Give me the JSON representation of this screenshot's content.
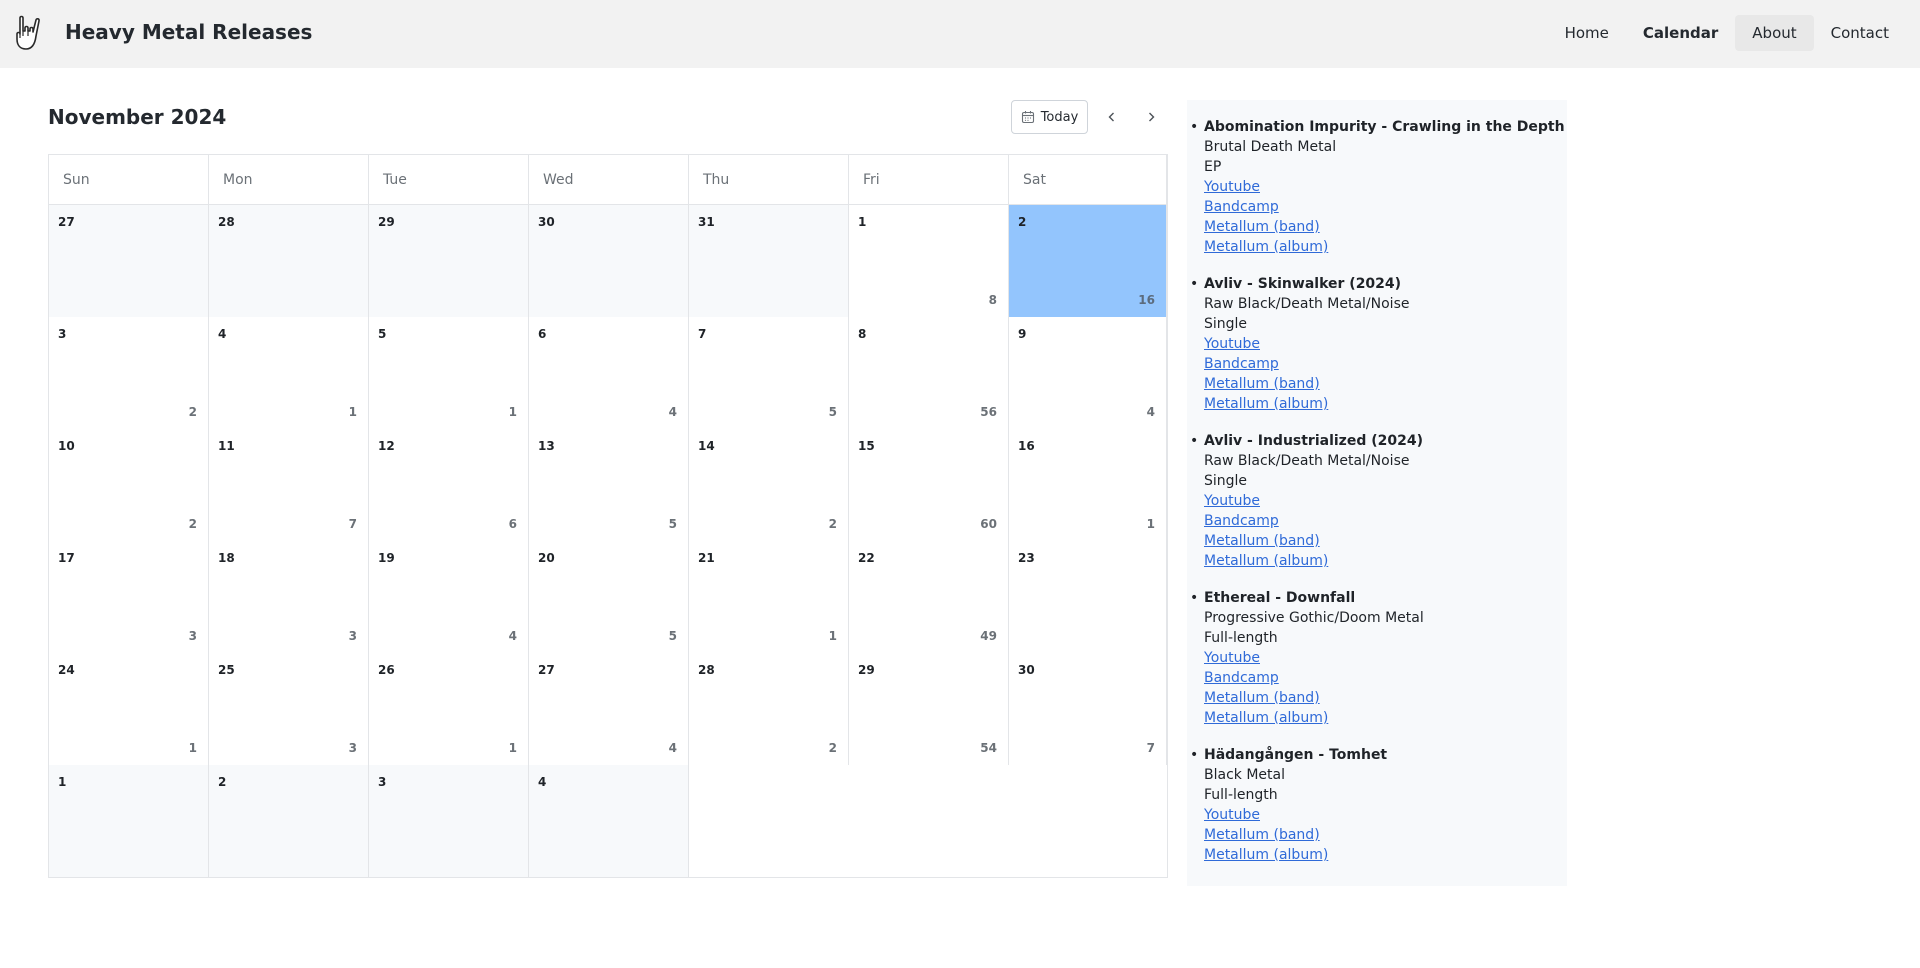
{
  "header": {
    "title": "Heavy Metal Releases",
    "nav": [
      {
        "label": "Home"
      },
      {
        "label": "Calendar"
      },
      {
        "label": "About"
      },
      {
        "label": "Contact"
      }
    ]
  },
  "calendar": {
    "month_title": "November 2024",
    "today_label": "Today",
    "weekdays": [
      "Sun",
      "Mon",
      "Tue",
      "Wed",
      "Thu",
      "Fri",
      "Sat"
    ],
    "weeks": [
      [
        {
          "num": "27",
          "count": "",
          "other": true
        },
        {
          "num": "28",
          "count": "",
          "other": true
        },
        {
          "num": "29",
          "count": "",
          "other": true
        },
        {
          "num": "30",
          "count": "",
          "other": true
        },
        {
          "num": "31",
          "count": "",
          "other": true
        },
        {
          "num": "1",
          "count": "8"
        },
        {
          "num": "2",
          "count": "16",
          "selected": true
        }
      ],
      [
        {
          "num": "3",
          "count": "2"
        },
        {
          "num": "4",
          "count": "1"
        },
        {
          "num": "5",
          "count": "1"
        },
        {
          "num": "6",
          "count": "4"
        },
        {
          "num": "7",
          "count": "5"
        },
        {
          "num": "8",
          "count": "56"
        },
        {
          "num": "9",
          "count": "4"
        }
      ],
      [
        {
          "num": "10",
          "count": "2"
        },
        {
          "num": "11",
          "count": "7"
        },
        {
          "num": "12",
          "count": "6"
        },
        {
          "num": "13",
          "count": "5"
        },
        {
          "num": "14",
          "count": "2"
        },
        {
          "num": "15",
          "count": "60"
        },
        {
          "num": "16",
          "count": "1"
        }
      ],
      [
        {
          "num": "17",
          "count": "3"
        },
        {
          "num": "18",
          "count": "3"
        },
        {
          "num": "19",
          "count": "4"
        },
        {
          "num": "20",
          "count": "5"
        },
        {
          "num": "21",
          "count": "1"
        },
        {
          "num": "22",
          "count": "49"
        },
        {
          "num": "23",
          "count": ""
        }
      ],
      [
        {
          "num": "24",
          "count": "1"
        },
        {
          "num": "25",
          "count": "3"
        },
        {
          "num": "26",
          "count": "1"
        },
        {
          "num": "27",
          "count": "4"
        },
        {
          "num": "28",
          "count": "2"
        },
        {
          "num": "29",
          "count": "54"
        },
        {
          "num": "30",
          "count": "7"
        }
      ],
      [
        {
          "num": "1",
          "count": "",
          "other": true
        },
        {
          "num": "2",
          "count": "",
          "other": true
        },
        {
          "num": "3",
          "count": "",
          "other": true
        },
        {
          "num": "4",
          "count": "",
          "other": true
        },
        {
          "num": "",
          "count": "",
          "blank": true
        },
        {
          "num": "",
          "count": "",
          "blank": true
        },
        {
          "num": "",
          "count": "",
          "blank": true
        }
      ]
    ]
  },
  "releases": [
    {
      "title": "Abomination Impurity - Crawling in the Depth",
      "genre": "Brutal Death Metal",
      "type": "EP",
      "links": [
        "Youtube",
        "Bandcamp",
        "Metallum (band)",
        "Metallum (album)"
      ]
    },
    {
      "title": "Avliv - Skinwalker (2024)",
      "genre": "Raw Black/Death Metal/Noise",
      "type": "Single",
      "links": [
        "Youtube",
        "Bandcamp",
        "Metallum (band)",
        "Metallum (album)"
      ]
    },
    {
      "title": "Avliv - Industrialized (2024)",
      "genre": "Raw Black/Death Metal/Noise",
      "type": "Single",
      "links": [
        "Youtube",
        "Bandcamp",
        "Metallum (band)",
        "Metallum (album)"
      ]
    },
    {
      "title": "Ethereal - Downfall",
      "genre": "Progressive Gothic/Doom Metal",
      "type": "Full-length",
      "links": [
        "Youtube",
        "Bandcamp",
        "Metallum (band)",
        "Metallum (album)"
      ]
    },
    {
      "title": "Hädangången - Tomhet",
      "genre": "Black Metal",
      "type": "Full-length",
      "links": [
        "Youtube",
        "Metallum (band)",
        "Metallum (album)"
      ]
    }
  ],
  "colors": {
    "selected_day": "#93c5fd",
    "link": "#2f6ad8",
    "header_bg": "#f2f2f2"
  }
}
